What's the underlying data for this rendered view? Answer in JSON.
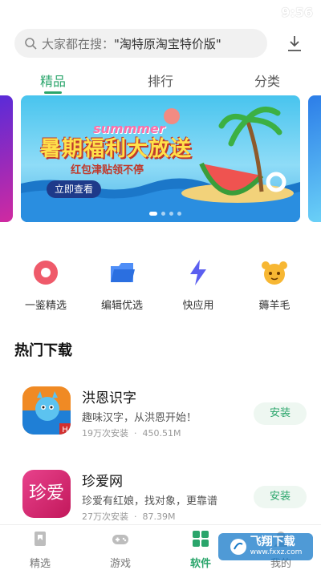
{
  "status_bar": {
    "time": "9:56"
  },
  "search": {
    "prefix": "大家都在搜：",
    "query": "\"淘特原淘宝特价版\""
  },
  "tabs": [
    {
      "label": "精品",
      "active": true
    },
    {
      "label": "排行",
      "active": false
    },
    {
      "label": "分类",
      "active": false
    }
  ],
  "banner": {
    "title": "暑期福利大放送",
    "summer": "summmer",
    "subtitle": "红包津贴领不停",
    "button": "立即查看"
  },
  "quick_links": [
    {
      "label": "一鉴精选",
      "icon": "target-icon"
    },
    {
      "label": "编辑优选",
      "icon": "folder-icon"
    },
    {
      "label": "快应用",
      "icon": "lightning-icon"
    },
    {
      "label": "薅羊毛",
      "icon": "sheep-icon"
    }
  ],
  "section_title": "热门下载",
  "apps": [
    {
      "name": "洪恩识字",
      "desc": "趣味汉字，从洪恩开始！",
      "installs": "19万次安装",
      "size": "450.51M",
      "button": "安装"
    },
    {
      "name": "珍爱网",
      "desc": "珍爱有红娘，找对象，更靠谱",
      "installs": "27万次安装",
      "size": "87.39M",
      "button": "安装",
      "icon_text": "珍爱"
    }
  ],
  "bottom_nav": [
    {
      "label": "精选",
      "active": false
    },
    {
      "label": "游戏",
      "active": false
    },
    {
      "label": "软件",
      "active": true
    },
    {
      "label": "我的",
      "active": false
    }
  ],
  "watermark": {
    "text": "飞翔下载",
    "domain": "www.fxxz.com"
  },
  "colors": {
    "accent": "#2aa56b"
  }
}
